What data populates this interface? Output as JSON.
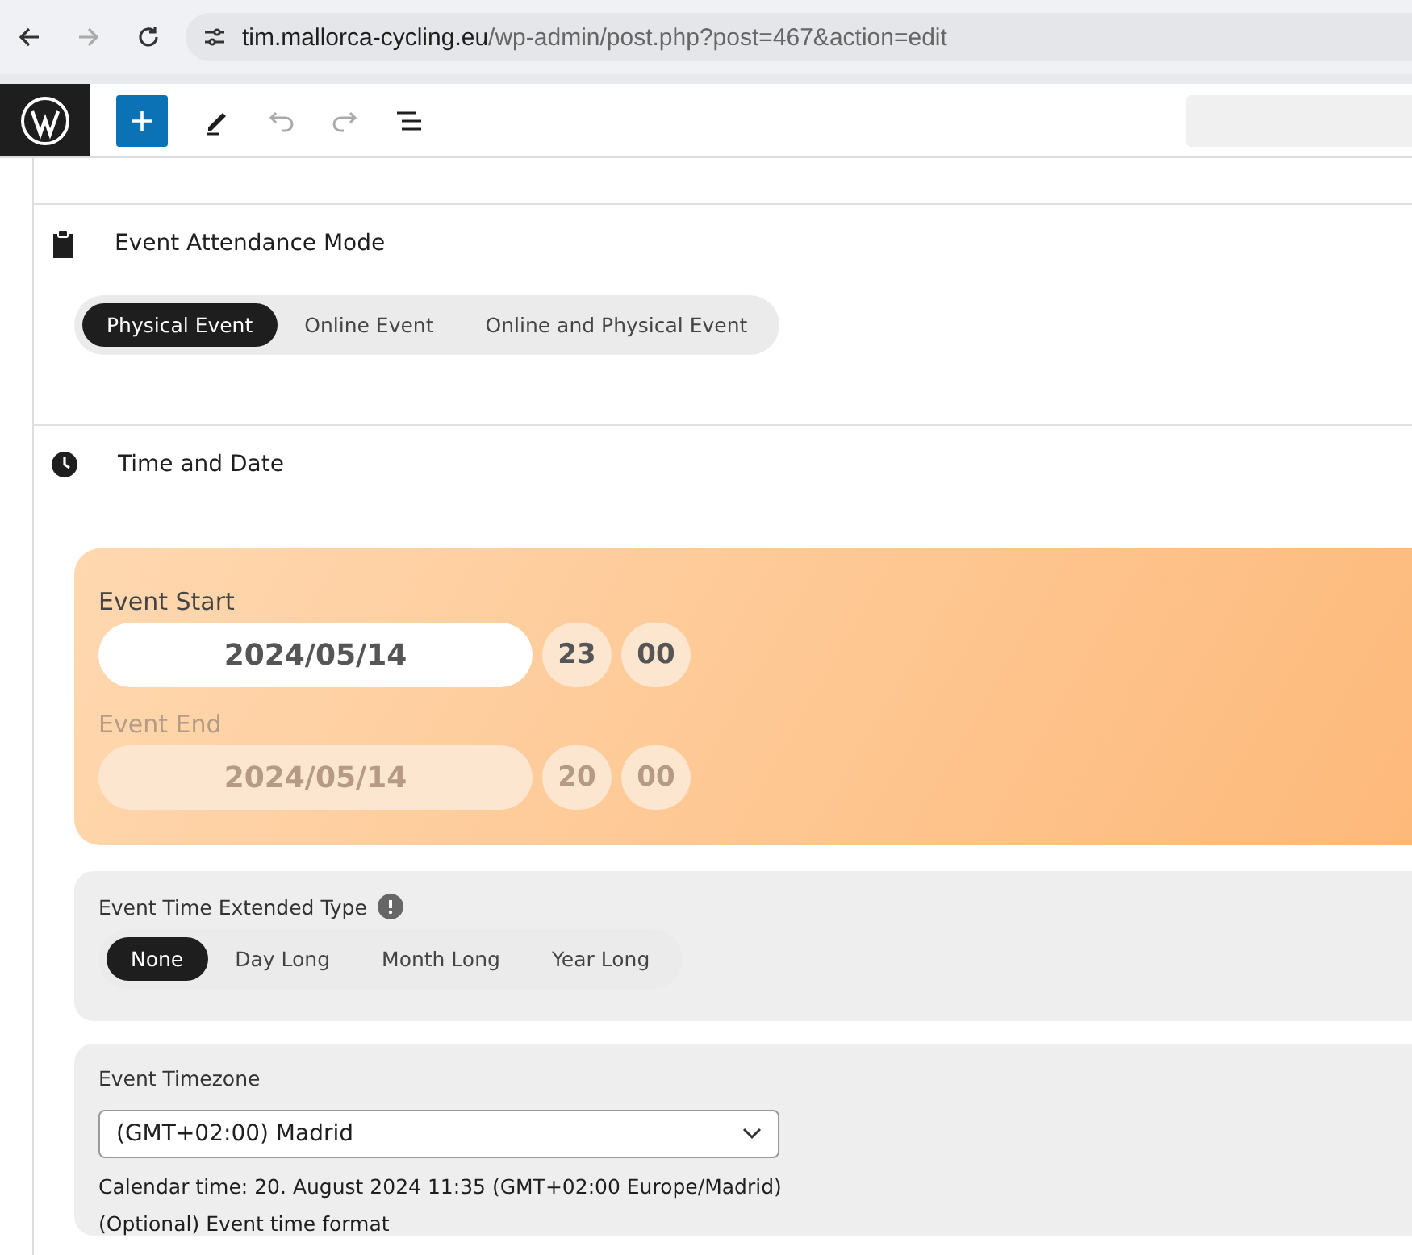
{
  "browser": {
    "url_host": "tim.mallorca-cycling.eu",
    "url_path": "/wp-admin/post.php?post=467&action=edit"
  },
  "attendance": {
    "title": "Event Attendance Mode",
    "options": [
      {
        "label": "Physical Event",
        "selected": true
      },
      {
        "label": "Online Event",
        "selected": false
      },
      {
        "label": "Online and Physical Event",
        "selected": false
      }
    ]
  },
  "time_date": {
    "title": "Time and Date",
    "start": {
      "label": "Event Start",
      "date": "2024/05/14",
      "hour": "23",
      "minute": "00",
      "disabled": false
    },
    "end": {
      "label": "Event End",
      "date": "2024/05/14",
      "hour": "20",
      "minute": "00",
      "disabled": true
    }
  },
  "extended": {
    "label": "Event Time Extended Type",
    "options": [
      {
        "label": "None",
        "selected": true
      },
      {
        "label": "Day Long",
        "selected": false
      },
      {
        "label": "Month Long",
        "selected": false
      },
      {
        "label": "Year Long",
        "selected": false
      }
    ]
  },
  "timezone": {
    "label": "Event Timezone",
    "value": "(GMT+02:00) Madrid",
    "calendar_time": "Calendar time: 20. August 2024 11:35 (GMT+02:00 Europe/Madrid)",
    "next_label": "(Optional) Event time format"
  }
}
